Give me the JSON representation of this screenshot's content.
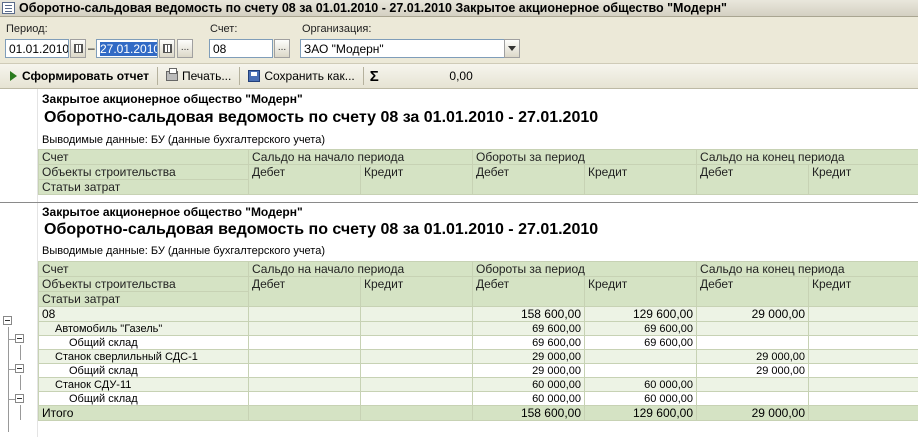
{
  "window": {
    "title": "Оборотно-сальдовая ведомость по счету 08 за 01.01.2010 - 27.01.2010 Закрытое акционерное общество \"Модерн\""
  },
  "filters": {
    "period_label": "Период:",
    "date_from": "01.01.2010",
    "date_dash": "–",
    "date_to": "27.01.2010",
    "account_label": "Счет:",
    "account": "08",
    "org_label": "Организация:",
    "organization": "ЗАО \"Модерн\"",
    "ellipsis": "..."
  },
  "toolbar": {
    "generate_label": "Сформировать отчет",
    "print_label": "Печать...",
    "save_label": "Сохранить как...",
    "sigma": "Σ",
    "sum_value": "0,00"
  },
  "report": {
    "org_name": "Закрытое акционерное общество \"Модерн\"",
    "title": "Оборотно-сальдовая ведомость по счету 08 за 01.01.2010 - 27.01.2010",
    "data_label": "Выводимые данные:  БУ (данные бухгалтерского учета)",
    "headers": {
      "account": "Счет",
      "objects": "Объекты строительства",
      "costs": "Статьи затрат",
      "opening": "Сальдо на начало периода",
      "turnover": "Обороты за период",
      "closing": "Сальдо на конец периода",
      "debit": "Дебет",
      "credit": "Кредит"
    },
    "rows": [
      {
        "name": "08",
        "od": "",
        "oc": "",
        "td": "158 600,00",
        "tc": "129 600,00",
        "cd": "29 000,00",
        "cc": ""
      },
      {
        "name": "Автомобиль \"Газель\"",
        "od": "",
        "oc": "",
        "td": "69 600,00",
        "tc": "69 600,00",
        "cd": "",
        "cc": ""
      },
      {
        "name": "Общий склад",
        "od": "",
        "oc": "",
        "td": "69 600,00",
        "tc": "69 600,00",
        "cd": "",
        "cc": ""
      },
      {
        "name": "Станок сверлильный СДС-1",
        "od": "",
        "oc": "",
        "td": "29 000,00",
        "tc": "",
        "cd": "29 000,00",
        "cc": ""
      },
      {
        "name": "Общий склад",
        "od": "",
        "oc": "",
        "td": "29 000,00",
        "tc": "",
        "cd": "29 000,00",
        "cc": ""
      },
      {
        "name": "Станок СДУ-11",
        "od": "",
        "oc": "",
        "td": "60 000,00",
        "tc": "60 000,00",
        "cd": "",
        "cc": ""
      },
      {
        "name": "Общий склад",
        "od": "",
        "oc": "",
        "td": "60 000,00",
        "tc": "60 000,00",
        "cd": "",
        "cc": ""
      }
    ],
    "total": {
      "name": "Итого",
      "od": "",
      "oc": "",
      "td": "158 600,00",
      "tc": "129 600,00",
      "cd": "29 000,00",
      "cc": ""
    }
  }
}
